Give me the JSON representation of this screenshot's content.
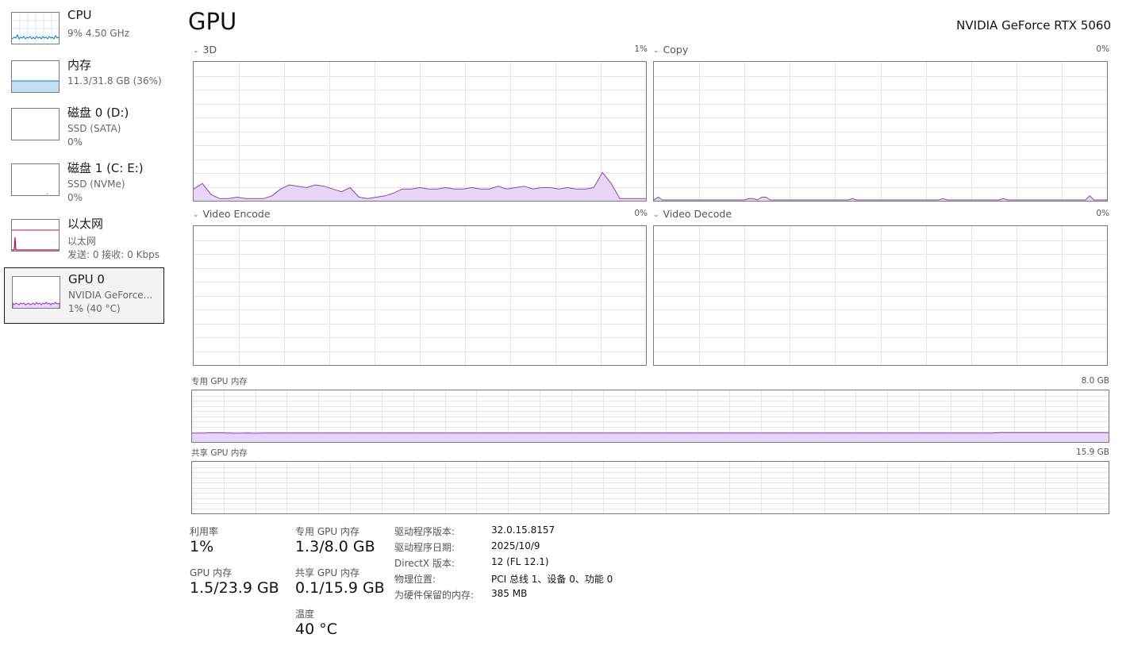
{
  "sidebar": {
    "items": [
      {
        "title": "CPU",
        "line1": "9% 4.50 GHz",
        "line2": ""
      },
      {
        "title": "内存",
        "line1": "11.3/31.8 GB (36%)",
        "line2": ""
      },
      {
        "title": "磁盘 0 (D:)",
        "line1": "SSD (SATA)",
        "line2": "0%"
      },
      {
        "title": "磁盘 1 (C: E:)",
        "line1": "SSD (NVMe)",
        "line2": "0%"
      },
      {
        "title": "以太网",
        "line1": "以太网",
        "line2": "发送: 0 接收: 0 Kbps"
      },
      {
        "title": "GPU 0",
        "line1": "NVIDIA GeForce...",
        "line2": "1% (40 °C)"
      }
    ]
  },
  "header": {
    "title": "GPU",
    "model": "NVIDIA GeForce RTX 5060"
  },
  "engines": {
    "e3d": {
      "label": "3D",
      "pct": "1%"
    },
    "copy": {
      "label": "Copy",
      "pct": "0%"
    },
    "encode": {
      "label": "Video Encode",
      "pct": "0%"
    },
    "decode": {
      "label": "Video Decode",
      "pct": "0%"
    }
  },
  "memory_graphs": {
    "dedicated": {
      "label": "专用 GPU 内存",
      "max": "8.0 GB"
    },
    "shared": {
      "label": "共享 GPU 内存",
      "max": "15.9 GB"
    }
  },
  "stats": {
    "utilization": {
      "label": "利用率",
      "value": "1%"
    },
    "gpu_memory": {
      "label": "GPU 内存",
      "value": "1.5/23.9 GB"
    },
    "dedicated": {
      "label": "专用 GPU 内存",
      "value": "1.3/8.0 GB"
    },
    "shared": {
      "label": "共享 GPU 内存",
      "value": "0.1/15.9 GB"
    },
    "temperature": {
      "label": "温度",
      "value": "40 °C"
    }
  },
  "info": [
    {
      "key": "驱动程序版本:",
      "value": "32.0.15.8157"
    },
    {
      "key": "驱动程序日期:",
      "value": "2025/10/9"
    },
    {
      "key": "DirectX 版本:",
      "value": "12 (FL 12.1)"
    },
    {
      "key": "物理位置:",
      "value": "PCI 总线 1、设备 0、功能 0"
    },
    {
      "key": "为硬件保留的内存:",
      "value": "385 MB"
    }
  ],
  "colors": {
    "gpu_line": "#8e44ad",
    "gpu_fill": "#e7d6f7",
    "cpu_line": "#117dbb",
    "mem_fill": "#c4def4",
    "net_line": "#a7125e",
    "grid": "#e4e4e4"
  },
  "graph_series": {
    "e3d": [
      8,
      12,
      4,
      1,
      1,
      2,
      1,
      1,
      1,
      3,
      8,
      11,
      10,
      9,
      11,
      10,
      8,
      6,
      9,
      2,
      1,
      2,
      3,
      5,
      8,
      8,
      9,
      8,
      8,
      9,
      8,
      8,
      9,
      8,
      8,
      10,
      8,
      9,
      10,
      8,
      9,
      9,
      8,
      9,
      8,
      8,
      9,
      20,
      12,
      1,
      1,
      1,
      1
    ],
    "copy": [
      0,
      2,
      0,
      0,
      0,
      0,
      0,
      0,
      0,
      0,
      0,
      0,
      0,
      0,
      0,
      0,
      0,
      0,
      0,
      0,
      0,
      0,
      1,
      1,
      0,
      2,
      2,
      0,
      0,
      0,
      0,
      0,
      0,
      0,
      0,
      0,
      0,
      0,
      0,
      0,
      0,
      0,
      0,
      0,
      0,
      0,
      1,
      0,
      0,
      0,
      0,
      0,
      0,
      0,
      0,
      0,
      0,
      0,
      0,
      0,
      0,
      0,
      0,
      0,
      0,
      0,
      0,
      1,
      0,
      0,
      0,
      0,
      0,
      0,
      0,
      0,
      0,
      0,
      0,
      0,
      0,
      1,
      0,
      0,
      0,
      0,
      0,
      0,
      0,
      0,
      0,
      0,
      0,
      0,
      0,
      0,
      0,
      0,
      0,
      0,
      0,
      3,
      0,
      0,
      0,
      0
    ],
    "dedicated": [
      16,
      16,
      16.6,
      16.6,
      16.4,
      15.8,
      16.4,
      15.8,
      16.4,
      16.4,
      16.4,
      16.4,
      16.4,
      16.4,
      16.4,
      16.4,
      16.4,
      16.4,
      16.4,
      16.4,
      16.4,
      16.4,
      16.4,
      16.4,
      16.4,
      16.4,
      16.4,
      16.4,
      16.4,
      16.4,
      16.4,
      16.4,
      16.4,
      16.4,
      16.4,
      16.4,
      16.4,
      16.4,
      16.4,
      16.4,
      16.4,
      16.4,
      16.4,
      16.4,
      16.4,
      16.4,
      16.4,
      16.4,
      16.4,
      16.4,
      16.4,
      16.4,
      16.4,
      16.4,
      16.4,
      16.4,
      16.4,
      16.4,
      16.4,
      16.4,
      16.4,
      16.4,
      16.4,
      16.4,
      16.4,
      16.4,
      16.4,
      16.4,
      16.4,
      16.4,
      16.4,
      16.4,
      16.4,
      16.4,
      16.4,
      16.4,
      16.4,
      16.4,
      16.4,
      16.4,
      16.4,
      16.4,
      16.4,
      16.4,
      16.4,
      16.4,
      16.4,
      16.4,
      16.4,
      17.2,
      17.2,
      17.2,
      17.2,
      17.2,
      17.2,
      17.2,
      17.2,
      17.2,
      17.2,
      17.2,
      17.2,
      17.2
    ]
  }
}
